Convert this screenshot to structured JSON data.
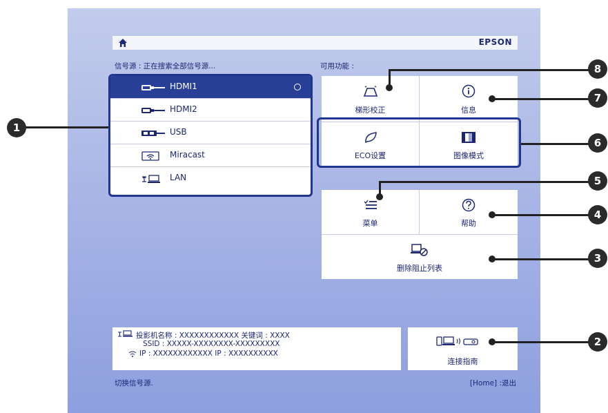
{
  "topbar": {
    "brand": "EPSON"
  },
  "source_section": {
    "label": "信号源 : 正在搜索全部信号源..."
  },
  "features_section": {
    "label": "可用功能 :"
  },
  "sources": [
    {
      "label": "HDMI1",
      "icon": "hdmi-connector-icon",
      "selected": true
    },
    {
      "label": "HDMI2",
      "icon": "hdmi-connector-icon",
      "selected": false
    },
    {
      "label": "USB",
      "icon": "usb-connector-icon",
      "selected": false
    },
    {
      "label": "Miracast",
      "icon": "wifi-icon",
      "selected": false
    },
    {
      "label": "LAN",
      "icon": "lan-icon",
      "selected": false
    }
  ],
  "features": {
    "keystone": "梯形校正",
    "info": "信息",
    "eco": "ECO设置",
    "image_mode": "图像模式",
    "menu": "菜单",
    "help": "帮助",
    "delete_blocklist": "删除阻止列表"
  },
  "info_panel": {
    "line1": "投影机名称 :  XXXXXXXXXXXX    关键词 :  XXXX",
    "line2": "SSID :  XXXXX-XXXXXXXX-XXXXXXXXX",
    "line3": "IP :  XXXXXXXXXXXX    IP :  XXXXXXXXXX"
  },
  "connection_guide": {
    "label": "连接指南"
  },
  "footer": {
    "left": "切换信号源.",
    "right": "[Home] :退出"
  },
  "callouts": [
    "1",
    "2",
    "3",
    "4",
    "5",
    "6",
    "7",
    "8"
  ],
  "colors": {
    "accent": "#283f97",
    "text": "#1b2775",
    "callout": "#2b2b2b"
  }
}
